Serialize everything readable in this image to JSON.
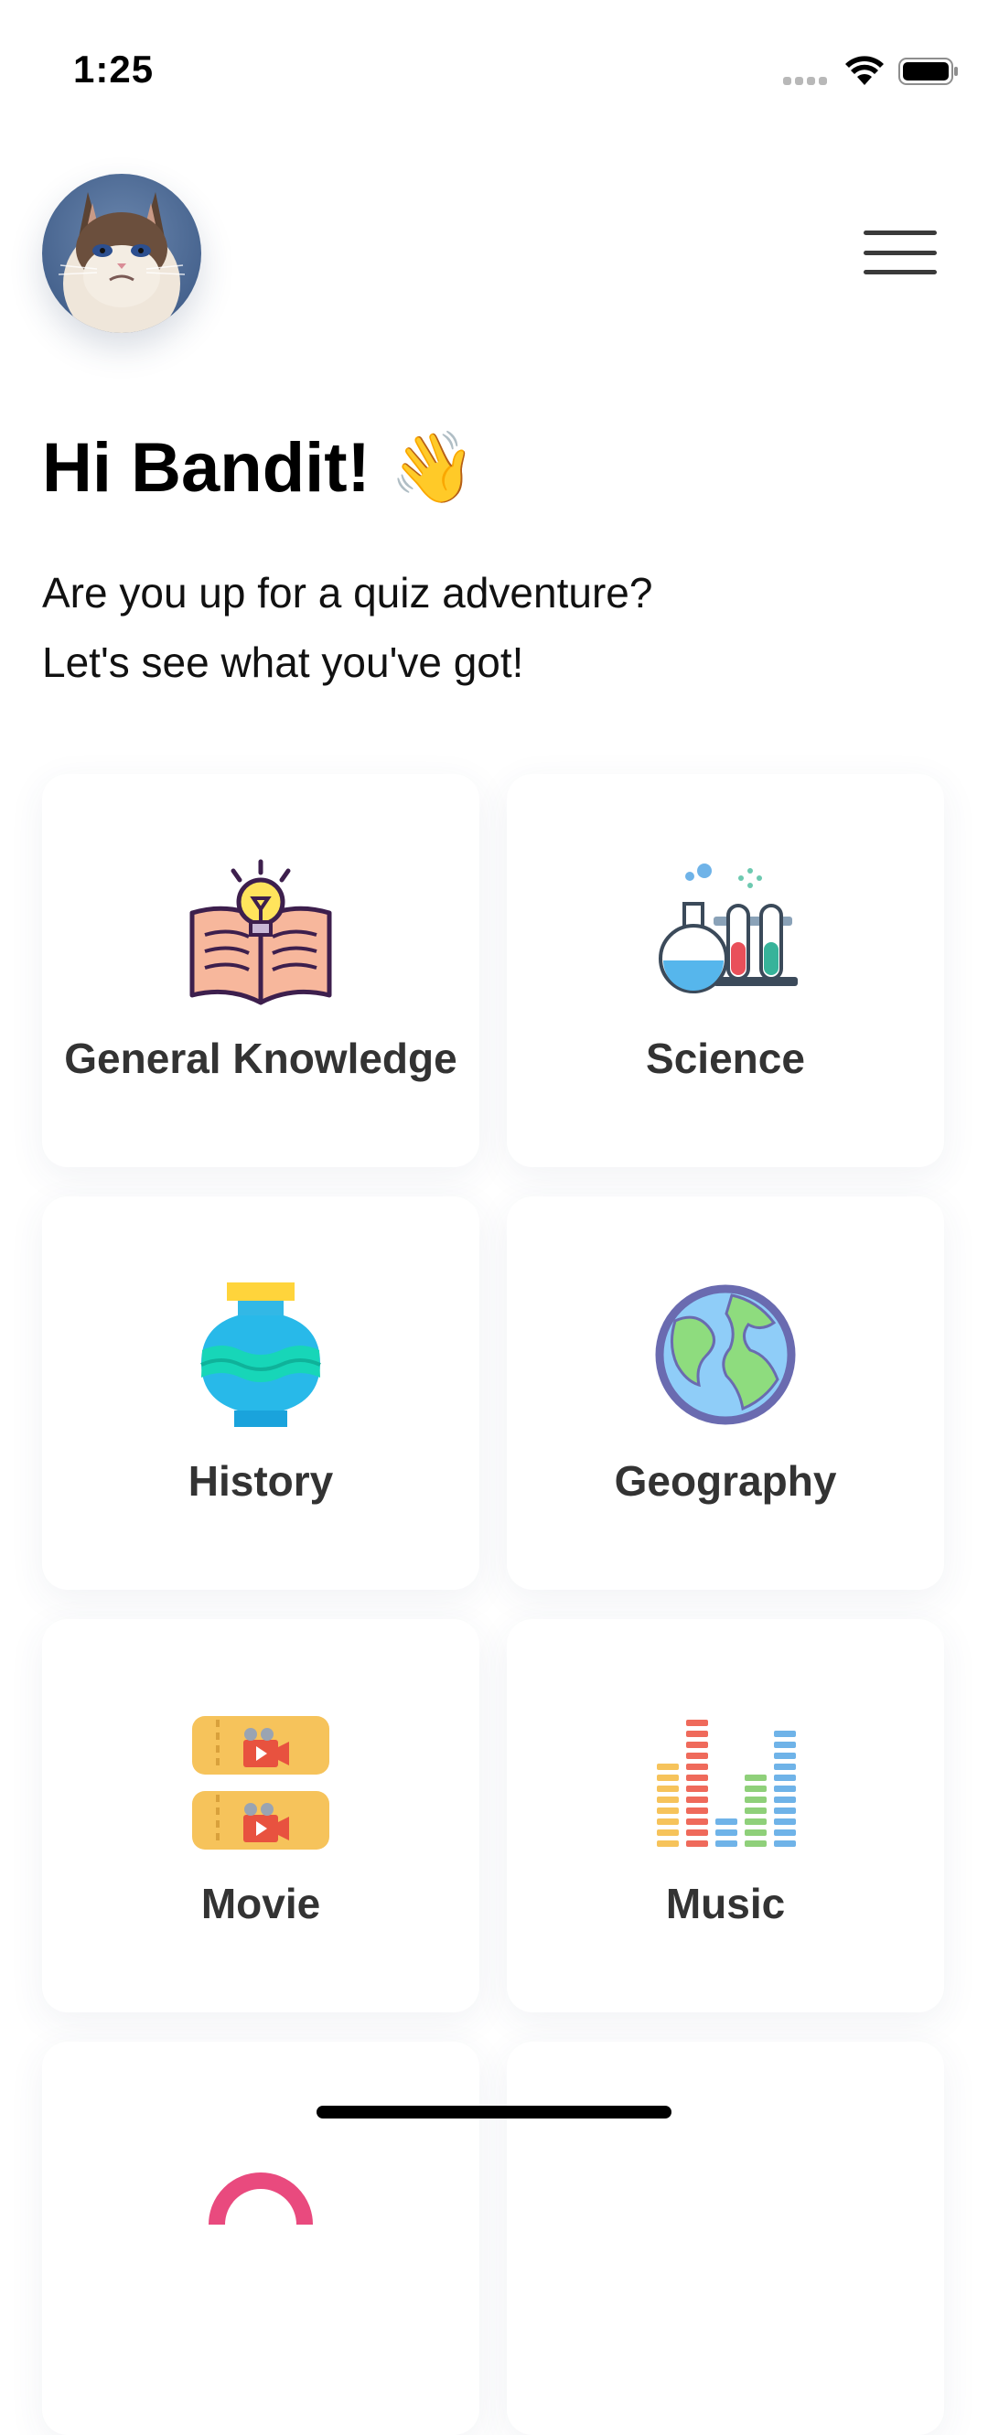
{
  "status_bar": {
    "time": "1:25"
  },
  "header": {
    "avatar_alt": "profile avatar",
    "menu_icon": "hamburger-menu-icon"
  },
  "greeting": {
    "title": "Hi Bandit!",
    "emoji": "👋"
  },
  "intro": {
    "line1": "Are you up for a quiz adventure?",
    "line2": "Let's see what you've got!"
  },
  "categories": [
    {
      "label": "General Knowledge",
      "icon": "open-book-lightbulb-icon"
    },
    {
      "label": "Science",
      "icon": "test-tubes-flask-icon"
    },
    {
      "label": "History",
      "icon": "ancient-vase-icon"
    },
    {
      "label": "Geography",
      "icon": "globe-icon"
    },
    {
      "label": "Movie",
      "icon": "movie-tickets-icon"
    },
    {
      "label": "Music",
      "icon": "equalizer-bars-icon"
    }
  ],
  "colors": {
    "background": "#ffffff",
    "card": "#ffffff",
    "label": "#333333",
    "text": "#000000"
  }
}
